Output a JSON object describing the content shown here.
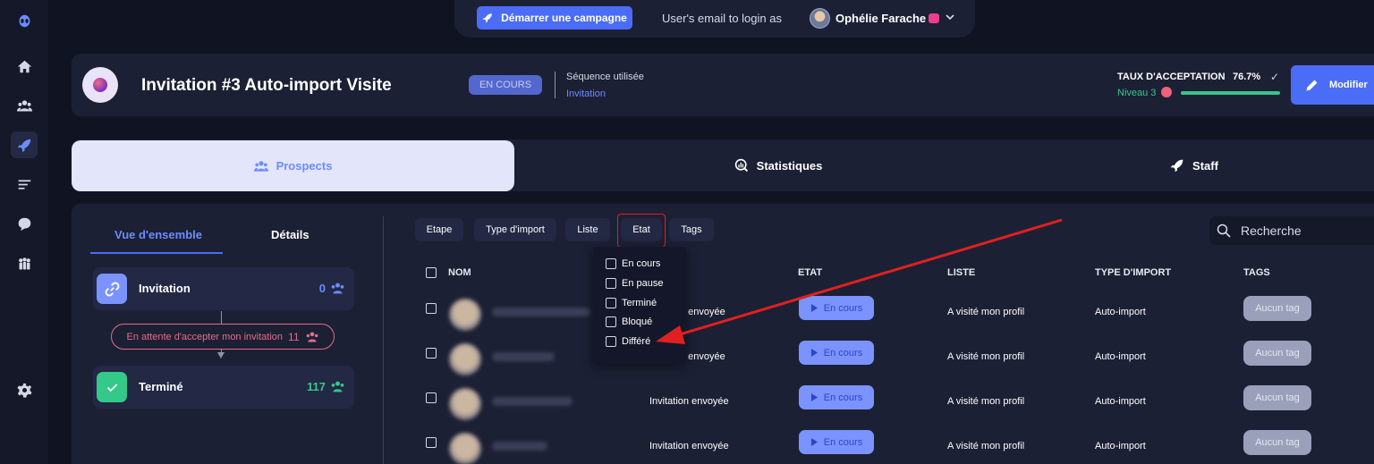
{
  "sidebar": {
    "icons": [
      "alien-logo-icon",
      "home-icon",
      "users-icon",
      "rocket-icon",
      "list-filter-icon",
      "chat-icon",
      "team-icon",
      "settings-icon"
    ],
    "active": "rocket-icon"
  },
  "topbar": {
    "campaign_button": "Démarrer une campagne",
    "login_text": "User's email to login as",
    "user_name": "Ophélie Farache"
  },
  "header": {
    "title": "Invitation #3 Auto-import Visite",
    "status_badge": "EN COURS",
    "sequence_label": "Séquence utilisée",
    "sequence_value": "Invitation",
    "rate_label": "TAUX D'ACCEPTATION",
    "rate_value": "76.7%",
    "level_label": "Niveau 3",
    "level_progress": 1.0,
    "modify_button": "Modifier"
  },
  "tabs": [
    {
      "label": "Prospects",
      "icon": "users-icon",
      "active": true
    },
    {
      "label": "Statistiques",
      "icon": "stats-search-icon",
      "active": false
    },
    {
      "label": "Staff",
      "icon": "rocket-icon",
      "active": false
    }
  ],
  "overview": {
    "tab_overview": "Vue d'ensemble",
    "tab_details": "Détails",
    "stage_invitation": {
      "name": "Invitation",
      "count": "0"
    },
    "waiting": {
      "label": "En attente d'accepter mon invitation",
      "count": "11"
    },
    "stage_done": {
      "name": "Terminé",
      "count": "117"
    }
  },
  "filters": [
    "Etape",
    "Type d'import",
    "Liste",
    "Etat",
    "Tags"
  ],
  "search_placeholder": "Recherche",
  "etat_dropdown": [
    "En cours",
    "En pause",
    "Terminé",
    "Bloqué",
    "Différé"
  ],
  "table": {
    "headers": {
      "nom": "NOM",
      "etat": "ETAT",
      "liste": "LISTE",
      "type": "TYPE D'IMPORT",
      "tags": "TAGS"
    },
    "rows": [
      {
        "etape": "n envoyée",
        "etat": "En cours",
        "liste": "A visité mon profil",
        "type": "Auto-import",
        "tags": "Aucun tag"
      },
      {
        "etape": "n envoyée",
        "etat": "En cours",
        "liste": "A visité mon profil",
        "type": "Auto-import",
        "tags": "Aucun tag"
      },
      {
        "etape": "Invitation envoyée",
        "etat": "En cours",
        "liste": "A visité mon profil",
        "type": "Auto-import",
        "tags": "Aucun tag"
      },
      {
        "etape": "Invitation envoyée",
        "etat": "En cours",
        "liste": "A visité mon profil",
        "type": "Auto-import",
        "tags": "Aucun tag"
      }
    ]
  },
  "colors": {
    "accent": "#4b6cf7",
    "success": "#34c889",
    "pink": "#e66b8b",
    "annotation": "#e02020"
  }
}
